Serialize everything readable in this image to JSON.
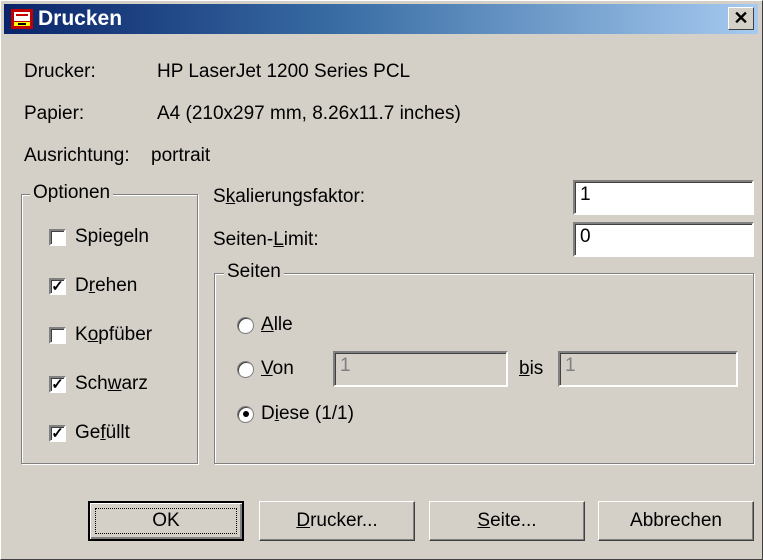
{
  "window": {
    "title": "Drucken",
    "close_glyph": "✕"
  },
  "info": {
    "printer_label": "Drucker:",
    "printer_value": "HP LaserJet 1200 Series PCL",
    "paper_label": "Papier:",
    "paper_value": "A4 (210x297 mm, 8.26x11.7 inches)",
    "orientation_label": "Ausrichtung:",
    "orientation_value": "portrait"
  },
  "options": {
    "legend": "Optionen",
    "items": [
      {
        "pre": "Spie",
        "u": "g",
        "post": "eln",
        "checked": false
      },
      {
        "pre": "D",
        "u": "r",
        "post": "ehen",
        "checked": true
      },
      {
        "pre": "K",
        "u": "o",
        "post": "pfüber",
        "checked": false
      },
      {
        "pre": "Sch",
        "u": "w",
        "post": "arz",
        "checked": true
      },
      {
        "pre": "Ge",
        "u": "f",
        "post": "üllt",
        "checked": true
      }
    ]
  },
  "scaling": {
    "pre": "S",
    "u": "k",
    "post": "alierungsfaktor:",
    "value": "1"
  },
  "limit": {
    "pre": "Seiten-",
    "u": "L",
    "post": "imit:",
    "value": "0"
  },
  "pages": {
    "legend": "Seiten",
    "all": {
      "pre": "",
      "u": "A",
      "post": "lle",
      "selected": false
    },
    "from": {
      "pre": "",
      "u": "V",
      "post": "on",
      "selected": false,
      "value": "1"
    },
    "to": {
      "pre": "",
      "u": "b",
      "post": "is",
      "value": "1"
    },
    "current": {
      "pre": "D",
      "u": "i",
      "post": "ese (1/1)",
      "selected": true
    }
  },
  "buttons": {
    "ok": "OK",
    "printer": {
      "pre": "",
      "u": "D",
      "post": "rucker..."
    },
    "page": {
      "pre": "",
      "u": "S",
      "post": "eite..."
    },
    "cancel": "Abbrechen"
  },
  "colors": {
    "titlebar_start": "#0a246a",
    "titlebar_end": "#a6caf0",
    "face": "#d4d0c8"
  }
}
